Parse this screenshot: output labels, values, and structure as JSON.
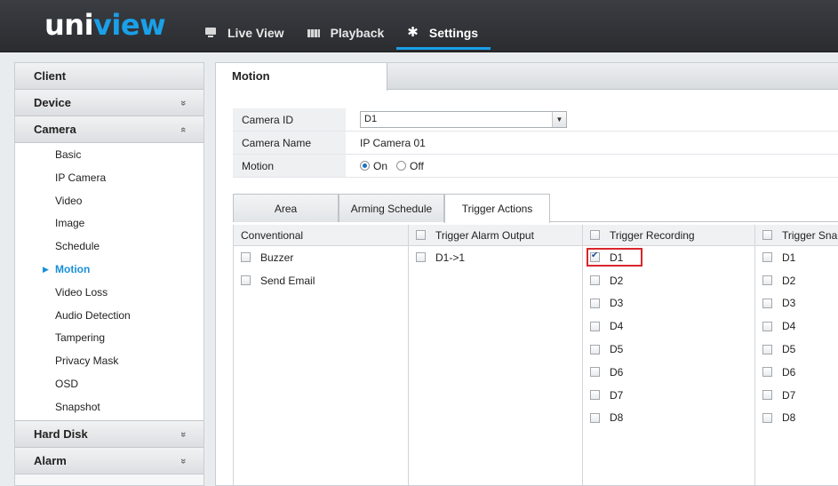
{
  "header": {
    "logo_main": "uni",
    "logo_accent": "view",
    "nav": [
      {
        "label": "Live View",
        "icon": "monitor-icon"
      },
      {
        "label": "Playback",
        "icon": "film-icon"
      },
      {
        "label": "Settings",
        "icon": "gear-icon",
        "active": true
      }
    ],
    "accent_color": "#1aa0e8"
  },
  "sidebar": {
    "sections": [
      {
        "label": "Client",
        "chevron": ""
      },
      {
        "label": "Device",
        "chevron": "»"
      },
      {
        "label": "Camera",
        "chevron": "«"
      }
    ],
    "camera_items": [
      "Basic",
      "IP Camera",
      "Video",
      "Image",
      "Schedule",
      "Motion",
      "Video Loss",
      "Audio Detection",
      "Tampering",
      "Privacy Mask",
      "OSD",
      "Snapshot"
    ],
    "active_item": "Motion",
    "bottom_sections": [
      {
        "label": "Hard Disk",
        "chevron": "»"
      },
      {
        "label": "Alarm",
        "chevron": "»"
      }
    ]
  },
  "main": {
    "tab_title": "Motion",
    "form": {
      "camera_id_label": "Camera ID",
      "camera_id_value": "D1",
      "camera_name_label": "Camera Name",
      "camera_name_value": "IP Camera 01",
      "motion_label": "Motion",
      "motion_on": "On",
      "motion_off": "Off",
      "motion_selected": "On"
    },
    "subtabs": [
      "Area",
      "Arming Schedule",
      "Trigger Actions"
    ],
    "active_subtab": "Trigger Actions",
    "columns": {
      "conventional": {
        "title": "Conventional",
        "items": [
          "Buzzer",
          "Send Email"
        ]
      },
      "alarm_output": {
        "title": "Trigger Alarm Output",
        "items": [
          "D1->1"
        ]
      },
      "recording": {
        "title": "Trigger Recording",
        "items": [
          "D1",
          "D2",
          "D3",
          "D4",
          "D5",
          "D6",
          "D7",
          "D8"
        ],
        "checked": [
          "D1"
        ]
      },
      "snapshot": {
        "title": "Trigger Snapshot",
        "items": [
          "D1",
          "D2",
          "D3",
          "D4",
          "D5",
          "D6",
          "D7",
          "D8"
        ]
      }
    },
    "highlight_color": "#d9262c"
  }
}
